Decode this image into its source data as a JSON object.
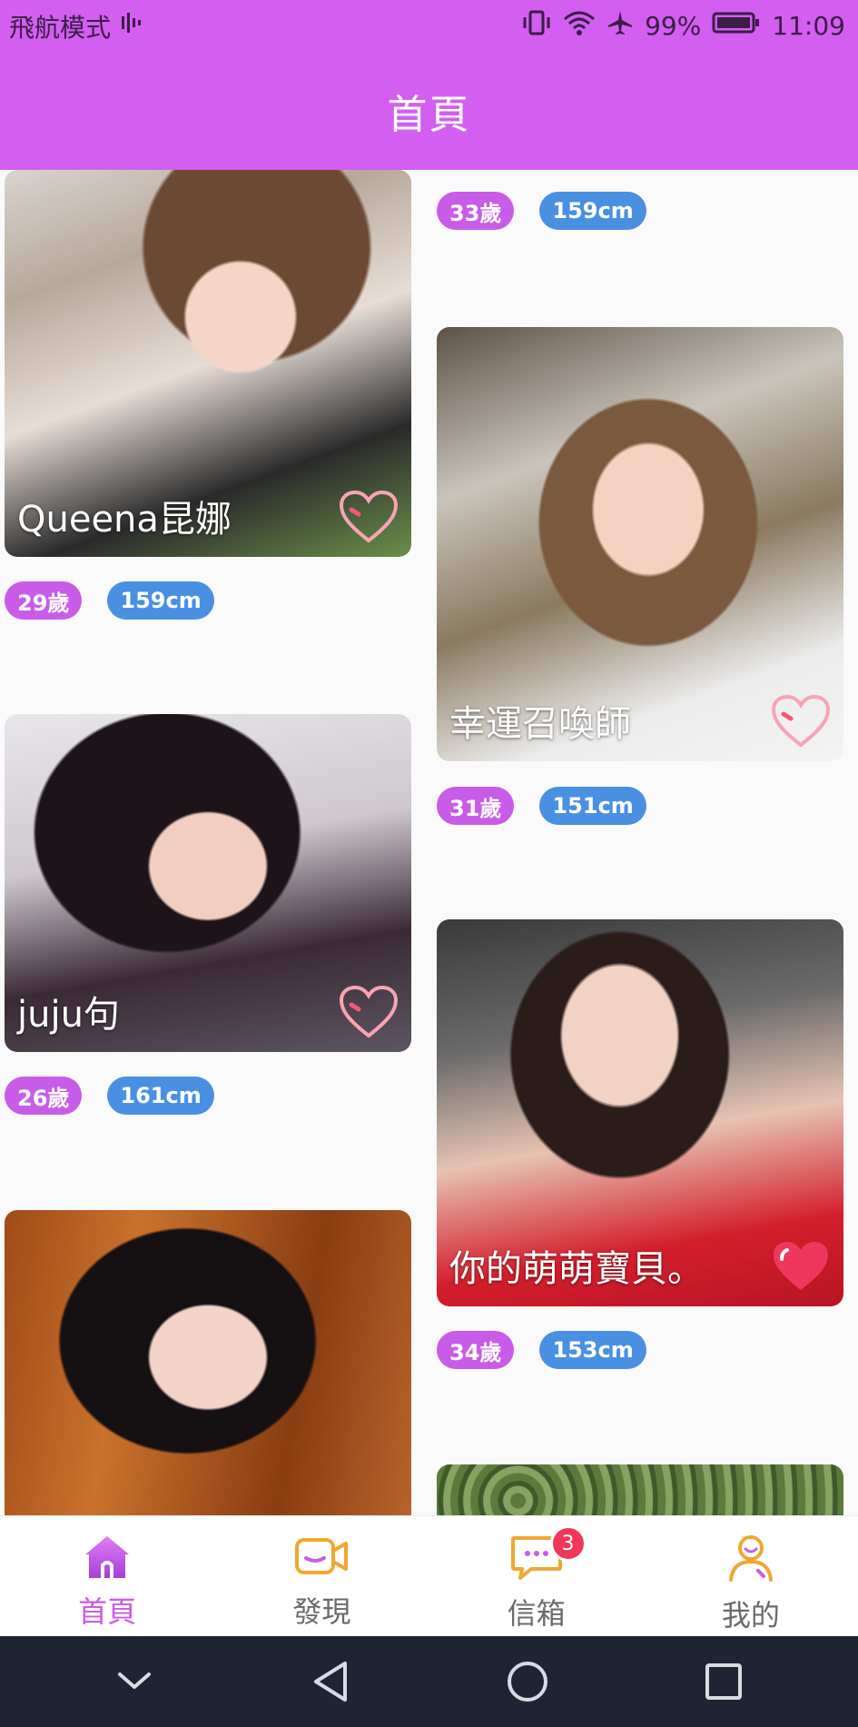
{
  "status_bar": {
    "mode": "飛航模式",
    "battery": "99%",
    "time": "11:09"
  },
  "header": {
    "title": "首頁"
  },
  "profiles": [
    {
      "name": "Queena昆娜",
      "age": "29歲",
      "height": "159cm",
      "liked": false
    },
    {
      "name": "",
      "age": "33歲",
      "height": "159cm",
      "liked": false
    },
    {
      "name": "幸運召喚師",
      "age": "31歲",
      "height": "151cm",
      "liked": false
    },
    {
      "name": "juju句",
      "age": "26歲",
      "height": "161cm",
      "liked": false
    },
    {
      "name": "你的萌萌寶貝。",
      "age": "34歲",
      "height": "153cm",
      "liked": true
    }
  ],
  "tabs": [
    {
      "label": "首頁",
      "icon": "home-icon",
      "active": true
    },
    {
      "label": "發現",
      "icon": "video-icon",
      "active": false
    },
    {
      "label": "信箱",
      "icon": "message-icon",
      "active": false,
      "badge": "3"
    },
    {
      "label": "我的",
      "icon": "profile-icon",
      "active": false
    }
  ],
  "colors": {
    "accent": "#d25ff0",
    "age_tag": "#c85ce8",
    "height_tag": "#4a90e2",
    "like": "#f0365a"
  }
}
